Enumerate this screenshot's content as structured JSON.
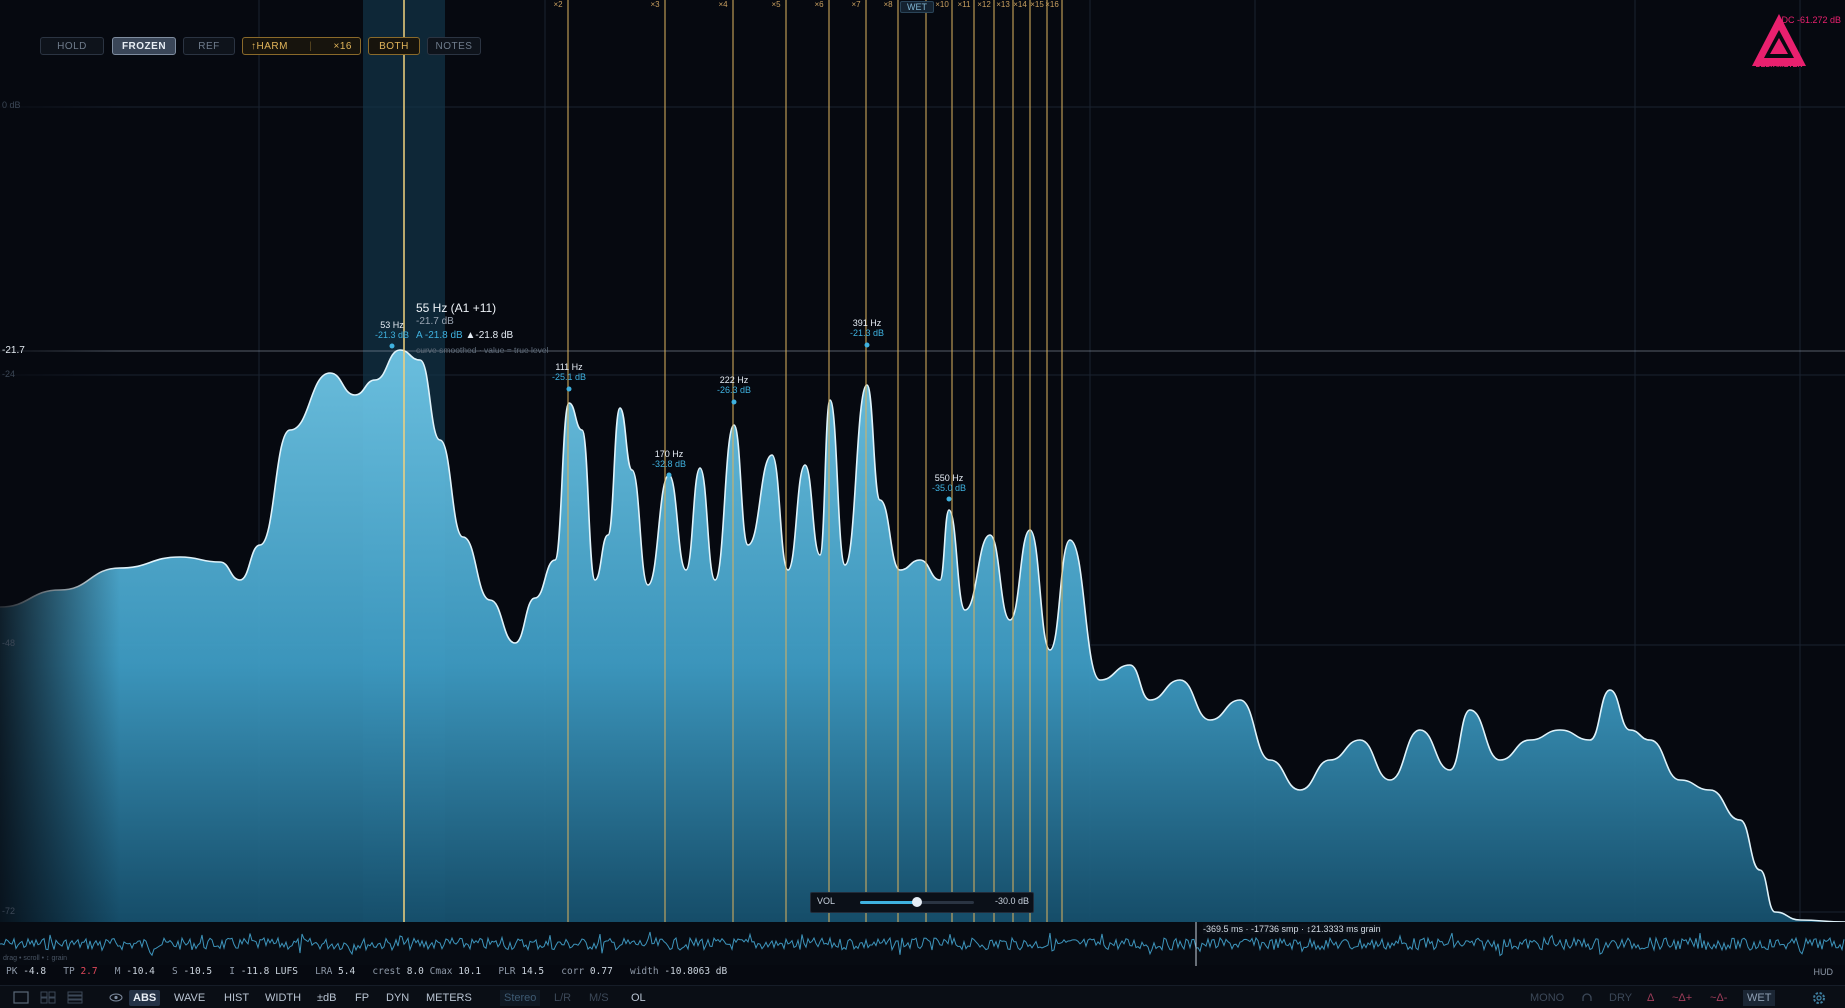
{
  "top_controls": {
    "hold": "HOLD",
    "frozen": "FROZEN",
    "ref": "REF",
    "harm": "↑HARM",
    "harm_count": "×16",
    "both": "BOTH",
    "notes": "NOTES",
    "wet_tag": "WET"
  },
  "harmonics": [
    "×2",
    "×3",
    "×4",
    "×5",
    "×6",
    "×7",
    "×8",
    "×9",
    "×10",
    "×11",
    "×12",
    "×13",
    "×14",
    "×15",
    "×16"
  ],
  "db_ticks": [
    "0 dB",
    "-24",
    "-48",
    "-72"
  ],
  "ref_line_value": "-21.7",
  "cursor": {
    "title": "55 Hz (A1 +11)",
    "level": "-21.7 dB",
    "a_label": "A",
    "a_value": "-21.8 dB",
    "peak": "▲-21.8 dB",
    "note": "curve smoothed · value = true level"
  },
  "peaks": [
    {
      "hz": "53 Hz",
      "db": "-21.3 dB"
    },
    {
      "hz": "111 Hz",
      "db": "-25.1 dB"
    },
    {
      "hz": "170 Hz",
      "db": "-32.8 dB"
    },
    {
      "hz": "222 Hz",
      "db": "-26.3 dB"
    },
    {
      "hz": "391 Hz",
      "db": "-21.3 dB"
    },
    {
      "hz": "550 Hz",
      "db": "-35.0 dB"
    }
  ],
  "logo": {
    "name": "DELTAMETER",
    "dc": "DC -61.272 dB",
    "accent": "#e8206e"
  },
  "volume": {
    "label": "VOL",
    "value": "-30.0 dB",
    "fraction": 0.5
  },
  "waveform_readout": "-369.5 ms · -17736 smp · ↕21.3333 ms grain",
  "waveform_hint": "drag • scroll • ↕ grain",
  "meters": {
    "pk_label": "PK",
    "pk": "-4.8",
    "tp_label": "TP",
    "tp": "2.7",
    "m_label": "M",
    "m": "-10.4",
    "s_label": "S",
    "s": "-10.5",
    "i_label": "I",
    "i": "-11.8 LUFS",
    "lra_label": "LRA",
    "lra": "5.4",
    "crest_label": "crest",
    "crest": "8.0",
    "cmax_label": "Cmax",
    "cmax": "10.1",
    "plr_label": "PLR",
    "plr": "14.5",
    "corr_label": "corr",
    "corr": "0.77",
    "width_label": "width",
    "width": "-10.8063 dB"
  },
  "hud": "HUD",
  "toolbar": {
    "abs": "ABS",
    "wave": "WAVE",
    "hist": "HIST",
    "width": "WIDTH",
    "pm_db": "±dB",
    "fp": "FP",
    "dyn": "DYN",
    "meters": "METERS",
    "stereo": "Stereo",
    "lr": "L/R",
    "ms": "M/S",
    "ol": "OL",
    "mono": "MONO",
    "dry": "DRY",
    "delta": "Δ",
    "delta_plus": "~Δ+",
    "delta_minus": "~Δ-",
    "wet": "WET"
  },
  "colors": {
    "spectrum": "#4fb4d8",
    "harmonic": "#d9b25f",
    "background": "#060910"
  }
}
